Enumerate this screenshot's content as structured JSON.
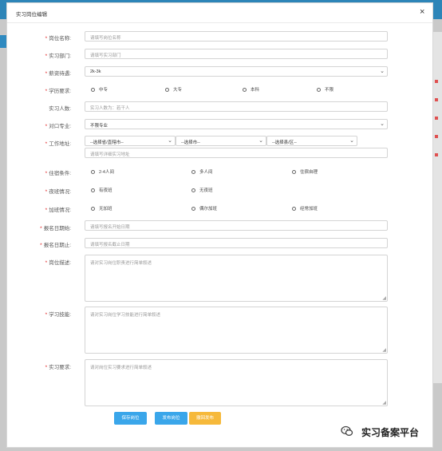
{
  "window": {
    "title": "实习岗位编辑"
  },
  "form": {
    "position_name": {
      "label": "岗位名称:",
      "placeholder": "请填写岗位名称"
    },
    "department": {
      "label": "实习部门:",
      "placeholder": "请填写实习部门"
    },
    "salary": {
      "label": "薪资待遇:",
      "value": "2k-3k"
    },
    "education": {
      "label": "学历要求:",
      "options": [
        "中专",
        "大专",
        "本科",
        "不限"
      ]
    },
    "headcount": {
      "label": "实习人数:",
      "placeholder": "实习人数为：若干人"
    },
    "major": {
      "label": "对口专业:",
      "value": "不限专业"
    },
    "address": {
      "label": "工作地址:",
      "province": "--选择省/直辖市--",
      "city": "--选择市--",
      "district": "--选择县/区--",
      "detail_placeholder": "请填写详细实习地址"
    },
    "accommodation": {
      "label": "住宿条件:",
      "options": [
        "2-4人间",
        "多人间",
        "住宿自理"
      ]
    },
    "night_shift": {
      "label": "夜班情况:",
      "options": [
        "有夜班",
        "无夜班"
      ]
    },
    "overtime": {
      "label": "加班情况:",
      "options": [
        "无加班",
        "偶尔加班",
        "经常加班"
      ]
    },
    "apply_start": {
      "label": "报名日期始:",
      "placeholder": "请填写报名开始日期"
    },
    "apply_end": {
      "label": "报名日期止:",
      "placeholder": "请填写报名截止日期"
    },
    "description": {
      "label": "岗位描述:",
      "placeholder": "请对实习岗位职责进行简单叙述"
    },
    "skills": {
      "label": "学习技能:",
      "placeholder": "请对实习岗位学习技能进行简单叙述"
    },
    "requirements": {
      "label": "实习要求:",
      "placeholder": "请对岗位实习要求进行简单叙述"
    }
  },
  "buttons": {
    "save": "保存岗位",
    "publish": "发布岗位",
    "unpublish": "撤回发布"
  },
  "watermark": {
    "text": "实习备案平台"
  },
  "colors": {
    "primary": "#3aa6ea",
    "warning": "#f6b93b",
    "required": "#e02020",
    "header": "#2d85b8"
  }
}
